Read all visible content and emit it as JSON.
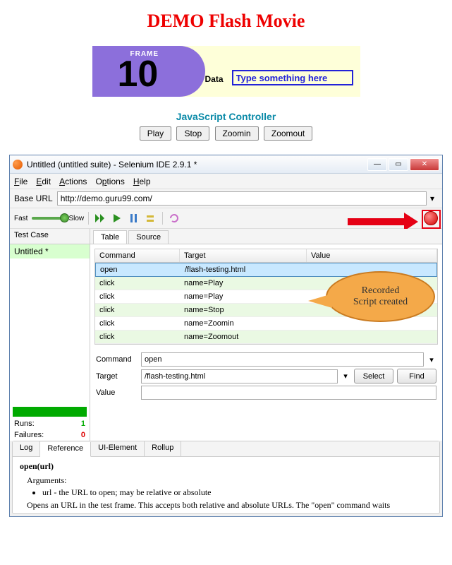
{
  "page": {
    "title": "DEMO Flash Movie"
  },
  "flash": {
    "frame_label": "FRAME",
    "frame_num": "10",
    "data_label": "Data",
    "input_value": "Type something here"
  },
  "controller": {
    "title": "JavaScript Controller",
    "buttons": {
      "play": "Play",
      "stop": "Stop",
      "zoomin": "Zoomin",
      "zoomout": "Zoomout"
    }
  },
  "ide": {
    "title": "Untitled (untitled suite) - Selenium IDE 2.9.1 *",
    "menus": {
      "file": "File",
      "edit": "Edit",
      "actions": "Actions",
      "options": "Options",
      "help": "Help"
    },
    "baseurl_label": "Base URL",
    "baseurl": "http://demo.guru99.com/",
    "speed": {
      "fast": "Fast",
      "slow": "Slow"
    },
    "testcase_header": "Test Case",
    "testcase_item": "Untitled *",
    "tabs": {
      "table": "Table",
      "source": "Source"
    },
    "table_head": {
      "command": "Command",
      "target": "Target",
      "value": "Value"
    },
    "rows": [
      {
        "cmd": "open",
        "tgt": "/flash-testing.html",
        "val": ""
      },
      {
        "cmd": "click",
        "tgt": "name=Play",
        "val": ""
      },
      {
        "cmd": "click",
        "tgt": "name=Play",
        "val": ""
      },
      {
        "cmd": "click",
        "tgt": "name=Stop",
        "val": ""
      },
      {
        "cmd": "click",
        "tgt": "name=Zoomin",
        "val": ""
      },
      {
        "cmd": "click",
        "tgt": "name=Zoomout",
        "val": ""
      }
    ],
    "form": {
      "command_label": "Command",
      "command_value": "open",
      "target_label": "Target",
      "target_value": "/flash-testing.html",
      "value_label": "Value",
      "value_value": "",
      "select_btn": "Select",
      "find_btn": "Find"
    },
    "stats": {
      "runs_label": "Runs:",
      "runs": "1",
      "failures_label": "Failures:",
      "failures": "0"
    },
    "bottom_tabs": {
      "log": "Log",
      "reference": "Reference",
      "uielement": "UI-Element",
      "rollup": "Rollup"
    },
    "reference": {
      "name": "open(url)",
      "args_label": "Arguments:",
      "arg1": "url - the URL to open; may be relative or absolute",
      "desc": "Opens an URL in the test frame. This accepts both relative and absolute URLs. The \"open\" command waits"
    },
    "callout": {
      "line1": "Recorded",
      "line2": "Script created"
    }
  }
}
